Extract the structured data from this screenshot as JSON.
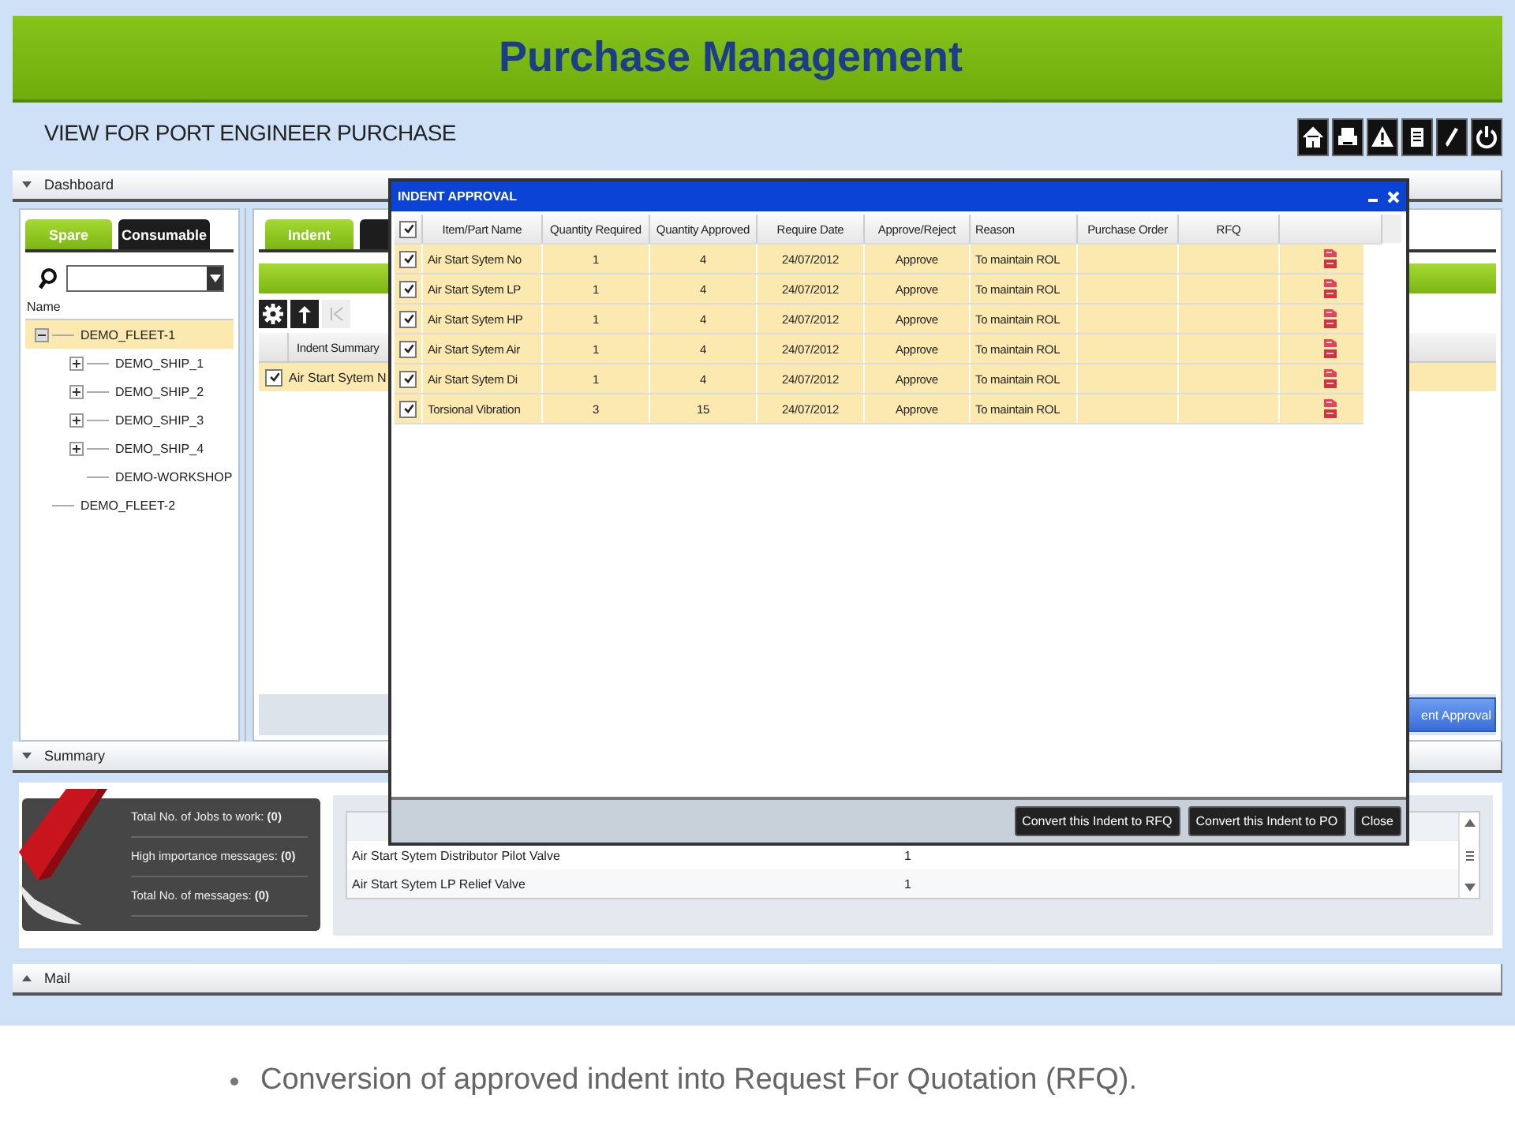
{
  "header": {
    "title": "Purchase Management",
    "subtitle": "VIEW FOR PORT ENGINEER PURCHASE"
  },
  "toolbar": [
    {
      "kind": "home"
    },
    {
      "kind": "print"
    },
    {
      "kind": "alert"
    },
    {
      "kind": "document"
    },
    {
      "kind": "edit"
    },
    {
      "kind": "power"
    }
  ],
  "dashboard": {
    "label": "Dashboard",
    "expanded": true,
    "left_tabs": [
      {
        "label": "Spare",
        "selected": true
      },
      {
        "label": "Consumable",
        "selected": false
      }
    ],
    "tree_header": "Name",
    "tree": [
      {
        "label": "DEMO_FLEET-1",
        "selected": true,
        "expanded": true,
        "children": [
          {
            "label": "DEMO_SHIP_1",
            "selected": false,
            "expanded": false,
            "has_children": true
          },
          {
            "label": "DEMO_SHIP_2",
            "selected": false,
            "expanded": false,
            "has_children": true
          },
          {
            "label": "DEMO_SHIP_3",
            "selected": false,
            "expanded": false,
            "has_children": true
          },
          {
            "label": "DEMO_SHIP_4",
            "selected": false,
            "expanded": false,
            "has_children": true
          },
          {
            "label": "DEMO-WORKSHOP",
            "selected": false,
            "has_children": false
          }
        ]
      },
      {
        "label": "DEMO_FLEET-2",
        "selected": false,
        "has_children": false
      }
    ],
    "right_tabs": [
      {
        "label": "Indent",
        "selected": true
      },
      {
        "selected": false
      }
    ],
    "grid": {
      "columns": [
        "Indent Summary"
      ],
      "rows": [
        {
          "checked": true,
          "cells": [
            "Air Start Sytem N"
          ]
        }
      ]
    },
    "action_button": "ent Approval"
  },
  "summary": {
    "label": "Summary",
    "expanded": true,
    "stats": [
      "Total No. of Jobs to work: **(0)**",
      "High importance messages: **(0)**",
      "Total No. of messages: **(0)**"
    ],
    "items": [
      {
        "name": "Air Start Sytem Distributor Pilot Valve",
        "quantity": "1"
      },
      {
        "name": "Air Start Sytem LP Relief Valve",
        "quantity": "1"
      }
    ]
  },
  "mail": {
    "label": "Mail",
    "expanded": false
  },
  "dialog": {
    "title": "INDENT APPROVAL",
    "header_checked": true,
    "columns": [
      "Item/Part Name",
      "Quantity Required",
      "Quantity Approved",
      "Require Date",
      "Approve/Reject",
      "Reason",
      "Purchase Order",
      "RFQ"
    ],
    "rows": [
      {
        "checked": true,
        "cells": [
          "Air Start Sytem No",
          "1",
          "4",
          "24/07/2012",
          "Approve",
          "To maintain ROL"
        ]
      },
      {
        "checked": true,
        "cells": [
          "Air Start Sytem LP",
          "1",
          "4",
          "24/07/2012",
          "Approve",
          "To maintain ROL"
        ]
      },
      {
        "checked": true,
        "cells": [
          "Air Start Sytem HP",
          "1",
          "4",
          "24/07/2012",
          "Approve",
          "To maintain ROL"
        ]
      },
      {
        "checked": true,
        "cells": [
          "Air Start Sytem Air",
          "1",
          "4",
          "24/07/2012",
          "Approve",
          "To maintain ROL"
        ]
      },
      {
        "checked": true,
        "cells": [
          "Air Start Sytem Di",
          "1",
          "4",
          "24/07/2012",
          "Approve",
          "To maintain ROL"
        ]
      },
      {
        "checked": true,
        "cells": [
          "Torsional Vibration",
          "3",
          "15",
          "24/07/2012",
          "Approve",
          "To maintain ROL"
        ]
      }
    ],
    "buttons": [
      "Convert this Indent to RFQ",
      "Convert this Indent to PO",
      "Close"
    ]
  },
  "caption": "Conversion of approved indent into Request For Quotation (RFQ)."
}
